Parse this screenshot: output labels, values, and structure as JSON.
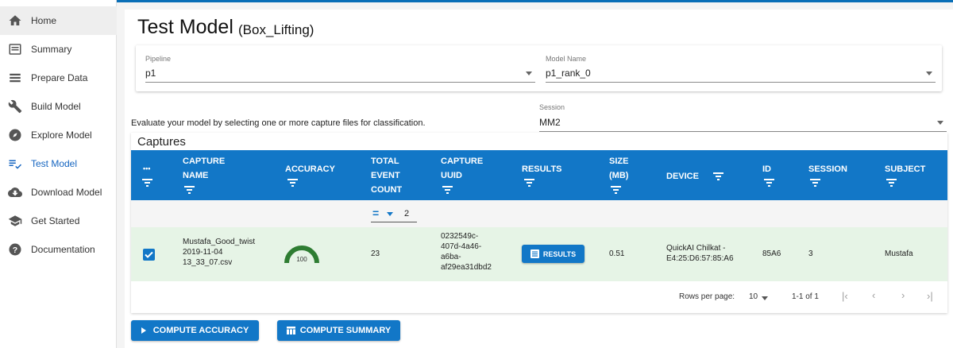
{
  "sidebar": {
    "items": [
      {
        "label": "Home",
        "icon": "home-icon"
      },
      {
        "label": "Summary",
        "icon": "summary-icon"
      },
      {
        "label": "Prepare Data",
        "icon": "list-icon"
      },
      {
        "label": "Build Model",
        "icon": "wrench-icon"
      },
      {
        "label": "Explore Model",
        "icon": "compass-icon"
      },
      {
        "label": "Test Model",
        "icon": "playlist-check-icon"
      },
      {
        "label": "Download Model",
        "icon": "cloud-download-icon"
      },
      {
        "label": "Get Started",
        "icon": "school-icon"
      },
      {
        "label": "Documentation",
        "icon": "help-icon"
      }
    ]
  },
  "page": {
    "title": "Test Model",
    "subtitle": "(Box_Lifting)"
  },
  "fields": {
    "pipeline_label": "Pipeline",
    "pipeline_value": "p1",
    "model_label": "Model Name",
    "model_value": "p1_rank_0",
    "session_label": "Session",
    "session_value": "MM2"
  },
  "instruction": "Evaluate your model by selecting one or more capture files for classification.",
  "captures": {
    "title": "Captures",
    "columns": {
      "more": "•••",
      "capture_name": [
        "CAPTURE",
        "NAME"
      ],
      "accuracy": "ACCURACY",
      "total_event_count": [
        "TOTAL",
        "EVENT",
        "COUNT"
      ],
      "capture_uuid": [
        "CAPTURE",
        "UUID"
      ],
      "results": "RESULTS",
      "size": [
        "SIZE",
        "(MB)"
      ],
      "device": "DEVICE",
      "id": "ID",
      "session": "SESSION",
      "subject": "SUBJECT"
    },
    "filter": {
      "operator": "=",
      "value": "2"
    },
    "rows": [
      {
        "capture_name": [
          "Mustafa_Good_twist",
          "2019-11-04",
          "13_33_07.csv"
        ],
        "accuracy": 100,
        "total_event_count": "23",
        "capture_uuid": [
          "0232549c-",
          "407d-4a46-",
          "a6ba-",
          "af29ea31dbd2"
        ],
        "results_label": "RESULTS",
        "size": "0.51",
        "device": [
          "QuickAI Chilkat -",
          "E4:25:D6:57:85:A6"
        ],
        "id": "85A6",
        "session": "3",
        "subject": "Mustafa"
      }
    ],
    "footer": {
      "rows_per_page_label": "Rows per page:",
      "rows_per_page_value": "10",
      "range": "1-1 of 1"
    }
  },
  "actions": {
    "compute_accuracy": "COMPUTE ACCURACY",
    "compute_summary": "COMPUTE SUMMARY"
  },
  "colors": {
    "primary": "#1277c7",
    "row_selected": "#e6f4e6",
    "gauge": "#2e7d32",
    "selected_nav": "#1565c0"
  }
}
